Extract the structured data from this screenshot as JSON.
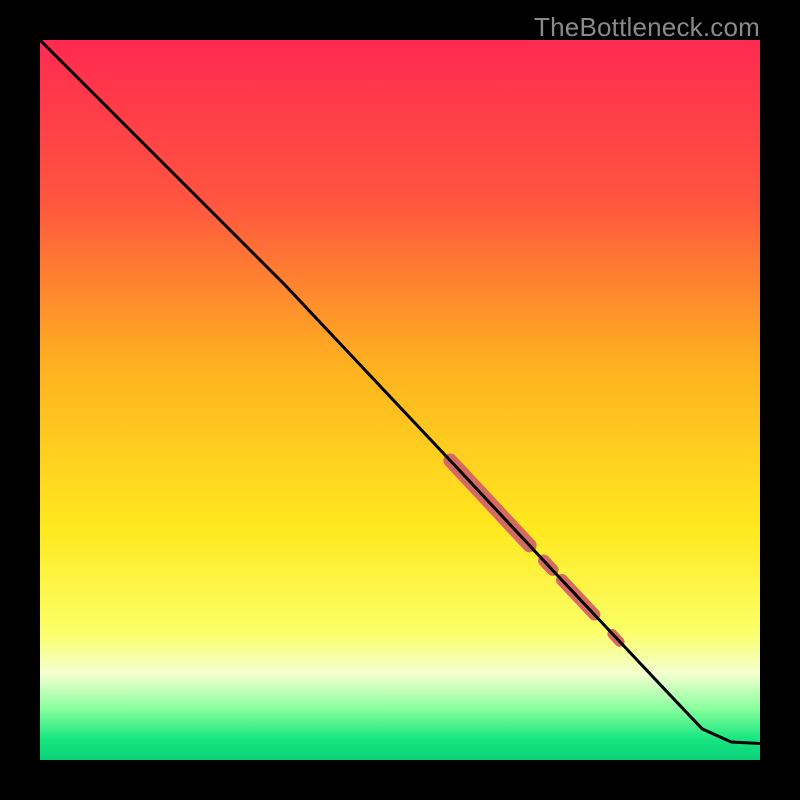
{
  "watermark": "TheBottleneck.com",
  "chart_data": {
    "type": "line",
    "title": "",
    "xlabel": "",
    "ylabel": "",
    "xlim": [
      0,
      100
    ],
    "ylim": [
      0,
      100
    ],
    "grid": false,
    "legend": false,
    "gradient_stops": [
      {
        "y": 0,
        "color": "#ff2a50"
      },
      {
        "y": 22,
        "color": "#ff5440"
      },
      {
        "y": 45,
        "color": "#ffb020"
      },
      {
        "y": 68,
        "color": "#ffe91f"
      },
      {
        "y": 82,
        "color": "#fbff66"
      },
      {
        "y": 88,
        "color": "#f4ffd0"
      },
      {
        "y": 93,
        "color": "#86ff9d"
      },
      {
        "y": 97,
        "color": "#18e680"
      },
      {
        "y": 100,
        "color": "#0ad27c"
      }
    ],
    "series": [
      {
        "name": "main-curve",
        "color": "#000000",
        "x": [
          0.0,
          8.0,
          16.0,
          23.0,
          28.0,
          34.0,
          42.0,
          50.0,
          58.0,
          65.0,
          72.0,
          80.0,
          88.0,
          92.0,
          96.0,
          100.0
        ],
        "y": [
          100.0,
          92.0,
          84.0,
          77.0,
          72.0,
          66.0,
          57.5,
          49.0,
          40.5,
          33.0,
          25.5,
          17.0,
          8.5,
          4.3,
          2.5,
          2.3
        ]
      }
    ],
    "highlight_segments": [
      {
        "name": "thick-segment-1",
        "color": "#d66a63",
        "width": 14,
        "x": [
          57.0,
          68.0
        ],
        "y": [
          41.6,
          29.8
        ]
      },
      {
        "name": "dot-1",
        "color": "#d66a63",
        "width": 12,
        "x": [
          70.0,
          71.2
        ],
        "y": [
          27.7,
          26.4
        ]
      },
      {
        "name": "thick-segment-2",
        "color": "#d66a63",
        "width": 12,
        "x": [
          72.5,
          77.0
        ],
        "y": [
          25.0,
          20.2
        ]
      },
      {
        "name": "dot-2",
        "color": "#d66a63",
        "width": 10,
        "x": [
          79.5,
          80.5
        ],
        "y": [
          17.5,
          16.4
        ]
      }
    ]
  }
}
